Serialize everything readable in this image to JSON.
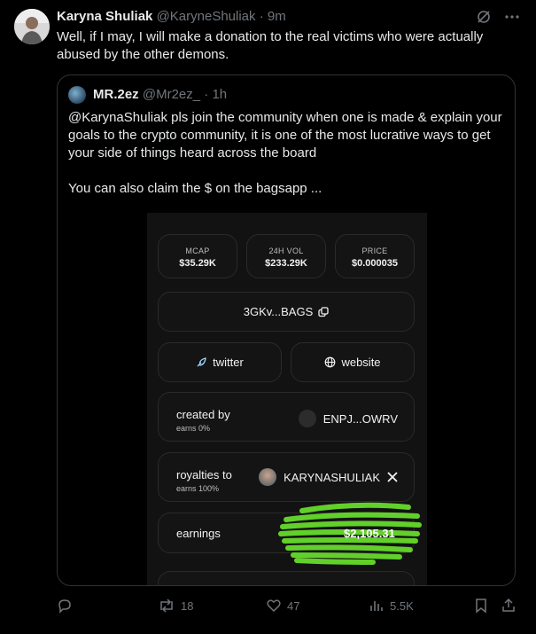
{
  "author": {
    "display_name": "Karyna Shuliak",
    "handle": "@KaryneShuliak",
    "time": "9m"
  },
  "tweet": {
    "text": "Well, if I may, I will make a donation to the real victims who were actually abused by the other demons."
  },
  "quote": {
    "display_name": "MR.2ez",
    "handle": "@Mr2ez_",
    "time": "1h",
    "paragraph_1": "@KarynaShuliak pls join the community when one is made & explain your goals to the crypto community, it is one of the most lucrative ways to get your side of things heard across the board",
    "paragraph_2": "You can also claim the $ on the bagsapp ..."
  },
  "app": {
    "stats": [
      {
        "label": "MCAP",
        "value": "$35.29K"
      },
      {
        "label": "24H VOL",
        "value": "$233.29K"
      },
      {
        "label": "PRICE",
        "value": "$0.000035"
      }
    ],
    "address": "3GKv...BAGS",
    "twitter_label": "twitter",
    "website_label": "website",
    "created_by": {
      "title": "created by",
      "sub": "earns 0%",
      "value": "ENPJ...OWRV"
    },
    "royalties": {
      "title": "royalties to",
      "sub": "earns 100%",
      "value": "KARYNASHULIAK"
    },
    "earnings": {
      "title": "earnings",
      "value": "$2,105.31"
    }
  },
  "actions": {
    "replies": "",
    "retweets": "18",
    "likes": "47",
    "views": "5.5K"
  },
  "colors": {
    "background": "#000000",
    "text": "#e7e9ea",
    "muted": "#71767b",
    "border": "#2f3336",
    "scribble": "#62d02a"
  }
}
